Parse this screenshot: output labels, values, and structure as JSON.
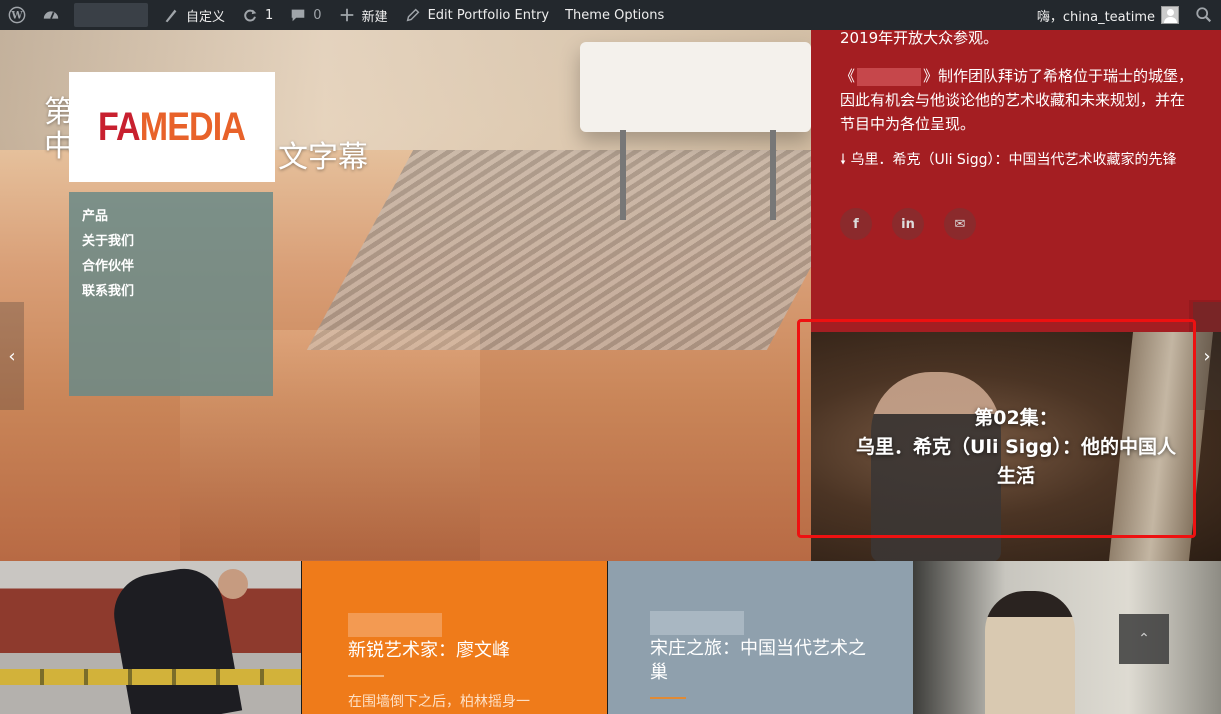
{
  "adminbar": {
    "customize": "自定义",
    "updates_count": "1",
    "comments_count": "0",
    "new": "新建",
    "edit_portfolio": "Edit Portfolio Entry",
    "theme_options": "Theme Options",
    "greeting": "嗨，china_teatime"
  },
  "hero": {
    "title_line1": "第",
    "title_line2": "中",
    "title_right": "文字幕",
    "logo_fa": "FA",
    "logo_media": "MEDIA",
    "menu": [
      "产品",
      "关于我们",
      "合作伙伴",
      "联系我们"
    ]
  },
  "red_panel": {
    "line1": "2019年开放大众参观。",
    "para2_open": "《",
    "para2_rest": "》制作团队拜访了希格位于瑞士的城堡，因此有机会与他谈论他的艺术收藏和未来规划，并在节目中为各位呈现。",
    "para3": "🠗 乌里．希克（Uli Sigg）：中国当代艺术收藏家的先锋",
    "social": [
      "f",
      "in",
      "✉"
    ]
  },
  "episode": {
    "title_l1": "第02集：",
    "title_l2": "乌里．希克（Uli Sigg）：他的中国人",
    "title_l3": "生活"
  },
  "tiles": {
    "tile2_title": "新锐艺术家：廖文峰",
    "tile2_excerpt": "在围墙倒下之后，柏林摇身一",
    "tile3_title_l1": "宋庄之旅：中国当代艺术之",
    "tile3_title_l2": "巢"
  },
  "colors": {
    "adminbar": "#23282d",
    "red_panel": "#a41e22",
    "orange_tile": "#ef7b1a",
    "gray_tile": "#8fa0ad",
    "menu_panel": "#6a8a87",
    "highlight": "#e11111"
  }
}
